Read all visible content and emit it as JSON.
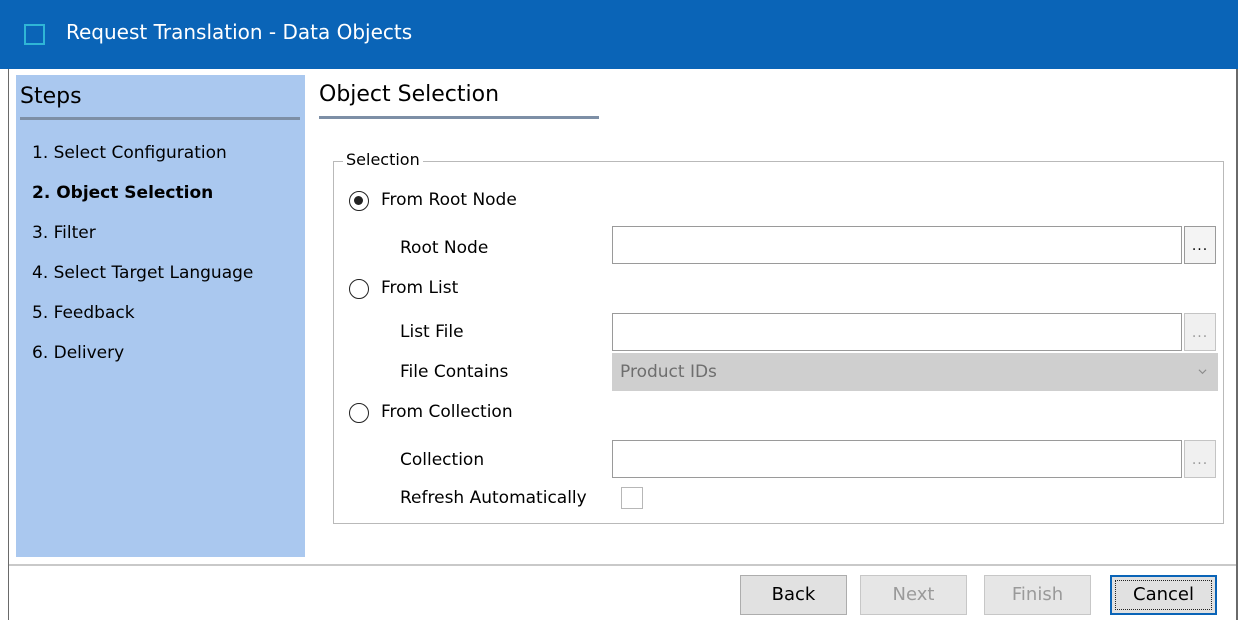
{
  "window": {
    "title": "Request Translation - Data Objects",
    "titlebar_color": "#0a64b7"
  },
  "steps": {
    "title": "Steps",
    "panel_color": "#aac8ef",
    "active_index": 1,
    "items": [
      "1. Select Configuration",
      "2. Object Selection",
      "3. Filter",
      "4. Select Target Language",
      "5. Feedback",
      "6. Delivery"
    ]
  },
  "page": {
    "title": "Object Selection"
  },
  "selection": {
    "legend": "Selection",
    "selected_option": "from_root_node",
    "from_root_node": {
      "label": "From Root Node",
      "root_node_label": "Root Node",
      "root_node_value": "",
      "browse_label": "..."
    },
    "from_list": {
      "label": "From List",
      "list_file_label": "List File",
      "list_file_value": "",
      "browse_label": "...",
      "file_contains_label": "File Contains",
      "file_contains_value": "Product IDs"
    },
    "from_collection": {
      "label": "From Collection",
      "collection_label": "Collection",
      "collection_value": "",
      "browse_label": "...",
      "refresh_label": "Refresh Automatically",
      "refresh_checked": false
    }
  },
  "footer": {
    "back_label": "Back",
    "next_label": "Next",
    "finish_label": "Finish",
    "cancel_label": "Cancel"
  }
}
